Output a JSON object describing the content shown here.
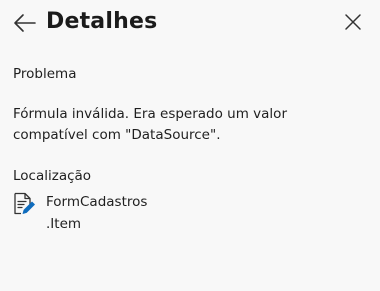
{
  "header": {
    "title": "Detalhes",
    "back_icon": "arrow-left-icon",
    "close_icon": "close-icon"
  },
  "problem": {
    "label": "Problema",
    "message": "Fórmula inválida. Era esperado um valor compatível com \"DataSource\"."
  },
  "location": {
    "label": "Localização",
    "icon": "document-edit-icon",
    "control": "FormCadastros",
    "property": ".Item"
  },
  "colors": {
    "background": "#f8f8f8",
    "text": "#1f1f1f",
    "icon_accent": "#0f6cbd"
  }
}
